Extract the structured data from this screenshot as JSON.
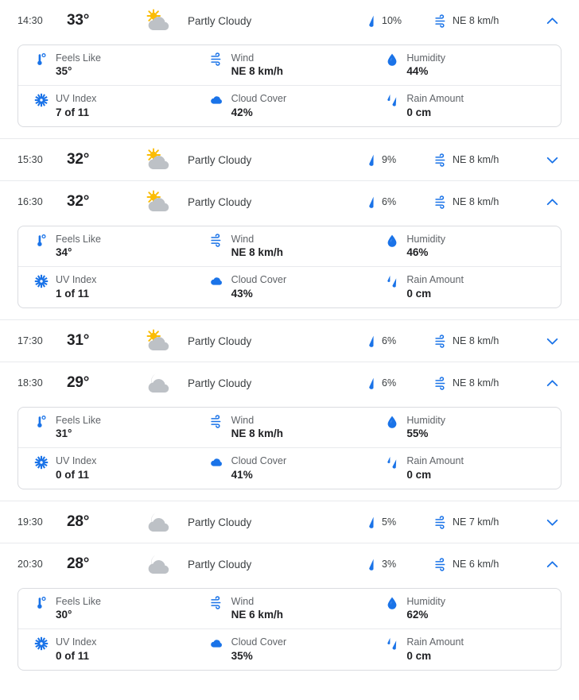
{
  "accent_blue": "#1a73e8",
  "cloud_gray": "#bdc1c6",
  "sun_yellow": "#fbbc04",
  "detail_labels": {
    "feels_like": "Feels Like",
    "wind": "Wind",
    "humidity": "Humidity",
    "uv_index": "UV Index",
    "cloud_cover": "Cloud Cover",
    "rain_amount": "Rain Amount"
  },
  "icon_names": {
    "feels_like": "thermometer-icon",
    "wind": "wind-icon",
    "humidity": "water-drop-icon",
    "uv_index": "sun-burst-icon",
    "cloud_cover": "cloud-filled-icon",
    "rain_amount": "rain-drops-icon",
    "precip": "raindrop-icon",
    "expand": "chevron-down-icon",
    "collapse": "chevron-up-icon",
    "day_partly_cloudy": "sun-behind-cloud-icon",
    "night_partly_cloudy": "moon-behind-cloud-icon"
  },
  "hours": [
    {
      "time": "14:30",
      "temp": "33°",
      "condition": "Partly Cloudy",
      "condition_icon": "day_partly_cloudy",
      "precip": "10%",
      "wind": "NE 8 km/h",
      "expanded": true,
      "details": {
        "feels_like": "35°",
        "wind": "NE 8 km/h",
        "humidity": "44%",
        "uv_index": "7 of 11",
        "cloud_cover": "42%",
        "rain_amount": "0 cm"
      }
    },
    {
      "time": "15:30",
      "temp": "32°",
      "condition": "Partly Cloudy",
      "condition_icon": "day_partly_cloudy",
      "precip": "9%",
      "wind": "NE 8 km/h",
      "expanded": false,
      "details": null
    },
    {
      "time": "16:30",
      "temp": "32°",
      "condition": "Partly Cloudy",
      "condition_icon": "day_partly_cloudy",
      "precip": "6%",
      "wind": "NE 8 km/h",
      "expanded": true,
      "details": {
        "feels_like": "34°",
        "wind": "NE 8 km/h",
        "humidity": "46%",
        "uv_index": "1 of 11",
        "cloud_cover": "43%",
        "rain_amount": "0 cm"
      }
    },
    {
      "time": "17:30",
      "temp": "31°",
      "condition": "Partly Cloudy",
      "condition_icon": "day_partly_cloudy",
      "precip": "6%",
      "wind": "NE 8 km/h",
      "expanded": false,
      "details": null
    },
    {
      "time": "18:30",
      "temp": "29°",
      "condition": "Partly Cloudy",
      "condition_icon": "night_partly_cloudy",
      "precip": "6%",
      "wind": "NE 8 km/h",
      "expanded": true,
      "details": {
        "feels_like": "31°",
        "wind": "NE 8 km/h",
        "humidity": "55%",
        "uv_index": "0 of 11",
        "cloud_cover": "41%",
        "rain_amount": "0 cm"
      }
    },
    {
      "time": "19:30",
      "temp": "28°",
      "condition": "Partly Cloudy",
      "condition_icon": "night_partly_cloudy",
      "precip": "5%",
      "wind": "NE 7 km/h",
      "expanded": false,
      "details": null
    },
    {
      "time": "20:30",
      "temp": "28°",
      "condition": "Partly Cloudy",
      "condition_icon": "night_partly_cloudy",
      "precip": "3%",
      "wind": "NE 6 km/h",
      "expanded": true,
      "details": {
        "feels_like": "30°",
        "wind": "NE 6 km/h",
        "humidity": "62%",
        "uv_index": "0 of 11",
        "cloud_cover": "35%",
        "rain_amount": "0 cm"
      }
    }
  ]
}
